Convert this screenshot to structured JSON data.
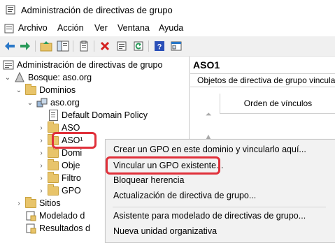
{
  "window": {
    "title": "Administración de directivas de grupo"
  },
  "menu": [
    "Archivo",
    "Acción",
    "Ver",
    "Ventana",
    "Ayuda"
  ],
  "toolbar": {
    "icons": [
      "back-icon",
      "forward-icon",
      "up-folder-icon",
      "show-tree-icon",
      "properties-icon",
      "delete-icon",
      "export-icon",
      "refresh-icon",
      "help-icon",
      "mmc-icon"
    ]
  },
  "tree": {
    "root": "Administración de directivas de grupo",
    "forest": "Bosque: aso.org",
    "domains": "Dominios",
    "domain": "aso.org",
    "default_policy": "Default Domain Policy",
    "aso": "ASO",
    "aso1": "ASO¹",
    "domain_controllers": "Domi",
    "objects": "Obje",
    "filters": "Filtro",
    "gpo": "GPO",
    "sites": "Sitios",
    "modeling": "Modelado d",
    "results": "Resultados d"
  },
  "right_pane": {
    "header": "ASO1",
    "tab": "Objetos de directiva de grupo vinculados",
    "column": "Orden de vínculos"
  },
  "context_menu": {
    "items": [
      "Crear un GPO en este dominio y vincularlo aquí...",
      "Vincular un GPO existente...",
      "Bloquear herencia",
      "Actualización de directiva de grupo...",
      "Asistente para modelado de directivas de grupo...",
      "Nueva unidad organizativa"
    ]
  },
  "colors": {
    "highlight": "#e0303a",
    "folder": "#e8c46a"
  }
}
